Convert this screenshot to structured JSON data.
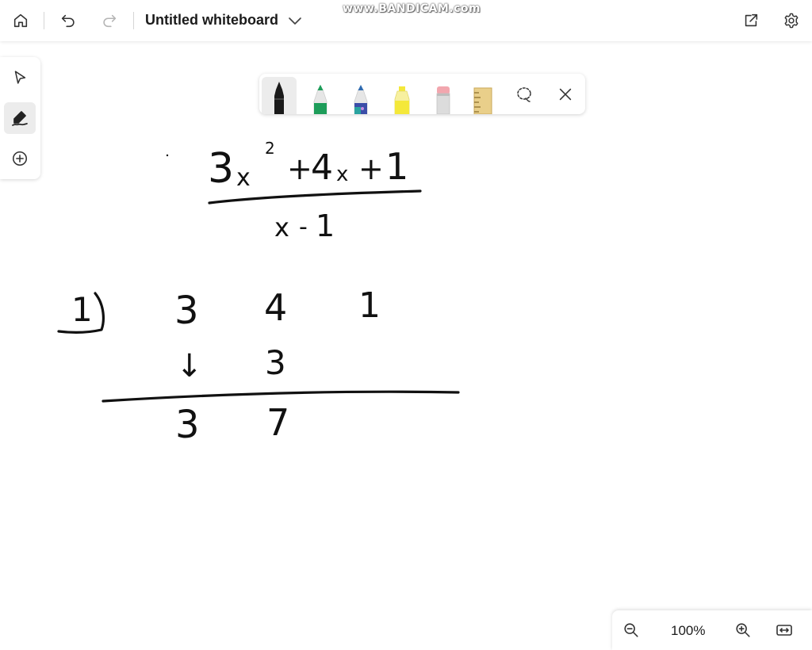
{
  "app": {
    "title": "Untitled whiteboard",
    "watermark": "www.BANDICAM.com"
  },
  "toolbar": {
    "icons": [
      "home-icon",
      "undo-icon",
      "redo-icon",
      "chevron-down-icon",
      "share-icon",
      "settings-icon"
    ]
  },
  "left_tools": [
    "select-icon",
    "pen-tool-icon",
    "add-icon"
  ],
  "pen_tray": {
    "pens": [
      {
        "name": "black-pen",
        "color": "#1a1a1a"
      },
      {
        "name": "green-pen",
        "color": "#1e9d5a"
      },
      {
        "name": "galaxy-pen",
        "color": "#3b6fb5"
      },
      {
        "name": "yellow-highlighter",
        "color": "#f4e83a"
      },
      {
        "name": "eraser",
        "color": "#f2a6ae"
      },
      {
        "name": "ruler",
        "color": "#e9cf8a"
      }
    ],
    "extra_icons": [
      "lasso-icon",
      "close-icon"
    ]
  },
  "zoom": {
    "level": "100%"
  },
  "ink": {
    "expression": {
      "numerator": [
        "3",
        "x",
        "2",
        "+",
        "4",
        "x",
        "+",
        "1"
      ],
      "denominator": [
        "x",
        "-",
        "1"
      ]
    },
    "synthetic_division": {
      "divisor": "1",
      "coefficients": [
        "3",
        "4",
        "1"
      ],
      "middle_row": [
        "↓",
        "3"
      ],
      "result_row": [
        "3",
        "7"
      ]
    }
  }
}
